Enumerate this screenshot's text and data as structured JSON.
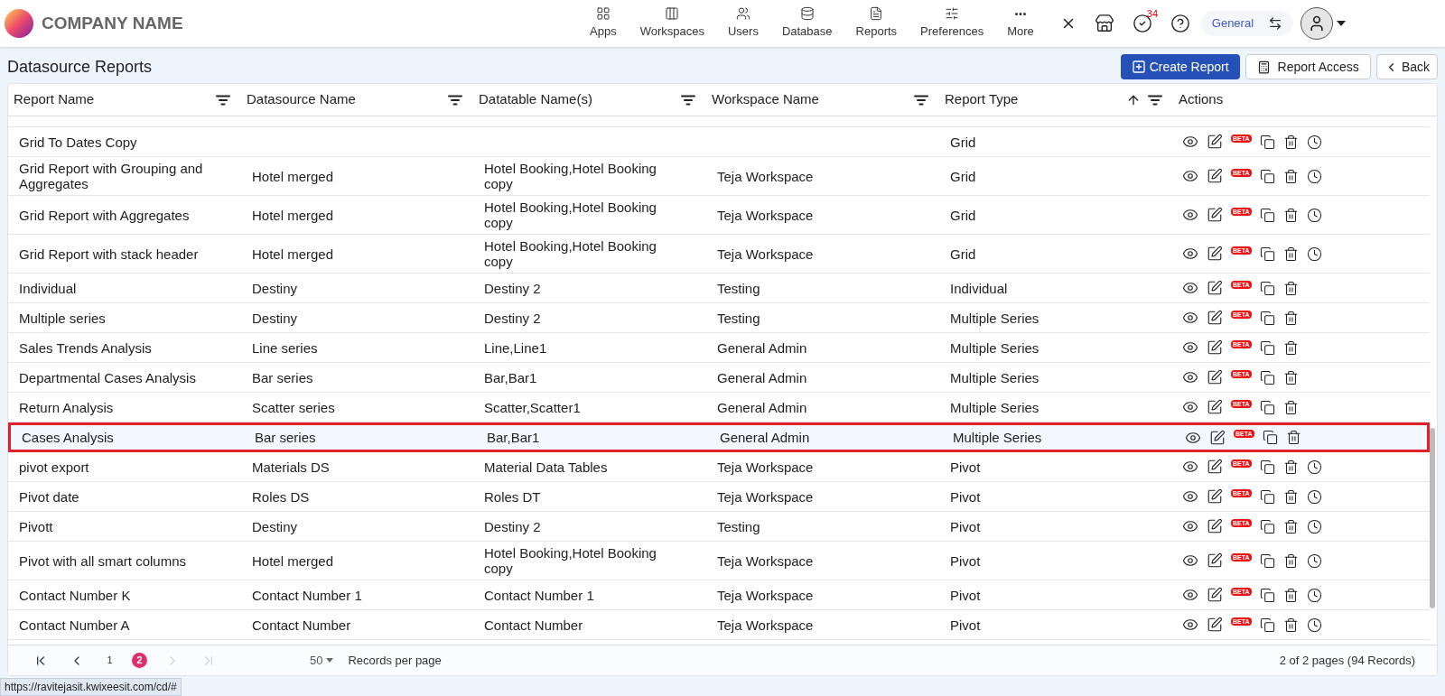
{
  "brand": {
    "name": "COMPANY NAME"
  },
  "nav": [
    {
      "label": "Apps"
    },
    {
      "label": "Workspaces"
    },
    {
      "label": "Users"
    },
    {
      "label": "Database"
    },
    {
      "label": "Reports"
    },
    {
      "label": "Preferences"
    },
    {
      "label": "More"
    }
  ],
  "header_tools": {
    "notification_count": "34",
    "workspace": "General"
  },
  "page": {
    "title": "Datasource Reports",
    "buttons": [
      {
        "label": "Create Report",
        "kind": "primary"
      },
      {
        "label": "Report Access",
        "kind": "access"
      },
      {
        "label": "Back",
        "kind": "back"
      }
    ]
  },
  "table": {
    "columns": [
      {
        "label": "Report Name",
        "sorted": false,
        "filter": true
      },
      {
        "label": "Datasource Name",
        "sorted": false,
        "filter": true
      },
      {
        "label": "Datatable Name(s)",
        "sorted": false,
        "filter": true
      },
      {
        "label": "Workspace Name",
        "sorted": false,
        "filter": true
      },
      {
        "label": "Report Type",
        "sorted": true,
        "filter": true
      },
      {
        "label": "Actions",
        "sorted": false,
        "filter": false
      }
    ],
    "rows": [
      {
        "cells": [
          "Grid To Dates Copy",
          "",
          "",
          "",
          "Grid"
        ],
        "beta": "BETA",
        "history": true,
        "highlighted": false
      },
      {
        "cells": [
          "Grid Report with Grouping and Aggregates",
          "Hotel merged",
          "Hotel Booking,Hotel Booking copy",
          "Teja Workspace",
          "Grid"
        ],
        "beta": "BETA",
        "history": true,
        "highlighted": false
      },
      {
        "cells": [
          "Grid Report with Aggregates",
          "Hotel merged",
          "Hotel Booking,Hotel Booking copy",
          "Teja Workspace",
          "Grid"
        ],
        "beta": "BETA",
        "history": true,
        "highlighted": false
      },
      {
        "cells": [
          "Grid Report with stack header",
          "Hotel merged",
          "Hotel Booking,Hotel Booking copy",
          "Teja Workspace",
          "Grid"
        ],
        "beta": "BETA",
        "history": true,
        "highlighted": false
      },
      {
        "cells": [
          "Individual",
          "Destiny",
          "Destiny 2",
          "Testing",
          "Individual"
        ],
        "beta": "BETA",
        "history": false,
        "highlighted": false
      },
      {
        "cells": [
          "Multiple series",
          "Destiny",
          "Destiny 2",
          "Testing",
          "Multiple Series"
        ],
        "beta": "BETA",
        "history": false,
        "highlighted": false
      },
      {
        "cells": [
          "Sales Trends Analysis",
          "Line series",
          "Line,Line1",
          "General Admin",
          "Multiple Series"
        ],
        "beta": "BETA",
        "history": false,
        "highlighted": false
      },
      {
        "cells": [
          "Departmental Cases Analysis",
          "Bar series",
          "Bar,Bar1",
          "General Admin",
          "Multiple Series"
        ],
        "beta": "BETA",
        "history": false,
        "highlighted": false
      },
      {
        "cells": [
          "Return Analysis",
          "Scatter series",
          "Scatter,Scatter1",
          "General Admin",
          "Multiple Series"
        ],
        "beta": "BETA",
        "history": false,
        "highlighted": false
      },
      {
        "cells": [
          "Cases Analysis",
          "Bar series",
          "Bar,Bar1",
          "General Admin",
          "Multiple Series"
        ],
        "beta": "BETA",
        "history": false,
        "highlighted": true
      },
      {
        "cells": [
          "pivot export",
          "Materials DS",
          "Material Data Tables",
          "Teja Workspace",
          "Pivot"
        ],
        "beta": "BETA",
        "history": true,
        "highlighted": false
      },
      {
        "cells": [
          "Pivot date",
          "Roles DS",
          "Roles DT",
          "Teja Workspace",
          "Pivot"
        ],
        "beta": "BETA",
        "history": true,
        "highlighted": false
      },
      {
        "cells": [
          "Pivott",
          "Destiny",
          "Destiny 2",
          "Testing",
          "Pivot"
        ],
        "beta": "BETA",
        "history": true,
        "highlighted": false
      },
      {
        "cells": [
          "Pivot with all smart columns",
          "Hotel merged",
          "Hotel Booking,Hotel Booking copy",
          "Teja Workspace",
          "Pivot"
        ],
        "beta": "BETA",
        "history": true,
        "highlighted": false
      },
      {
        "cells": [
          "Contact Number K",
          "Contact Number 1",
          "Contact Number 1",
          "Teja Workspace",
          "Pivot"
        ],
        "beta": "BETA",
        "history": true,
        "highlighted": false
      },
      {
        "cells": [
          "Contact Number A",
          "Contact Number",
          "Contact Number",
          "Teja Workspace",
          "Pivot"
        ],
        "beta": "BETA",
        "history": true,
        "highlighted": false
      }
    ]
  },
  "pagination": {
    "controls": [
      {
        "kind": "first",
        "disabled": false
      },
      {
        "kind": "prev",
        "disabled": false
      }
    ],
    "pages": [
      {
        "label": "1",
        "selected": false
      },
      {
        "label": "2",
        "selected": true
      }
    ],
    "end_controls": [
      {
        "kind": "next",
        "disabled": true
      },
      {
        "kind": "last",
        "disabled": true
      }
    ],
    "page_size": "50",
    "page_size_label": "Records per page",
    "summary": "2 of 2 pages (94 Records)"
  },
  "status_url": "https://ravitejasit.kwixeesit.com/cd/#"
}
